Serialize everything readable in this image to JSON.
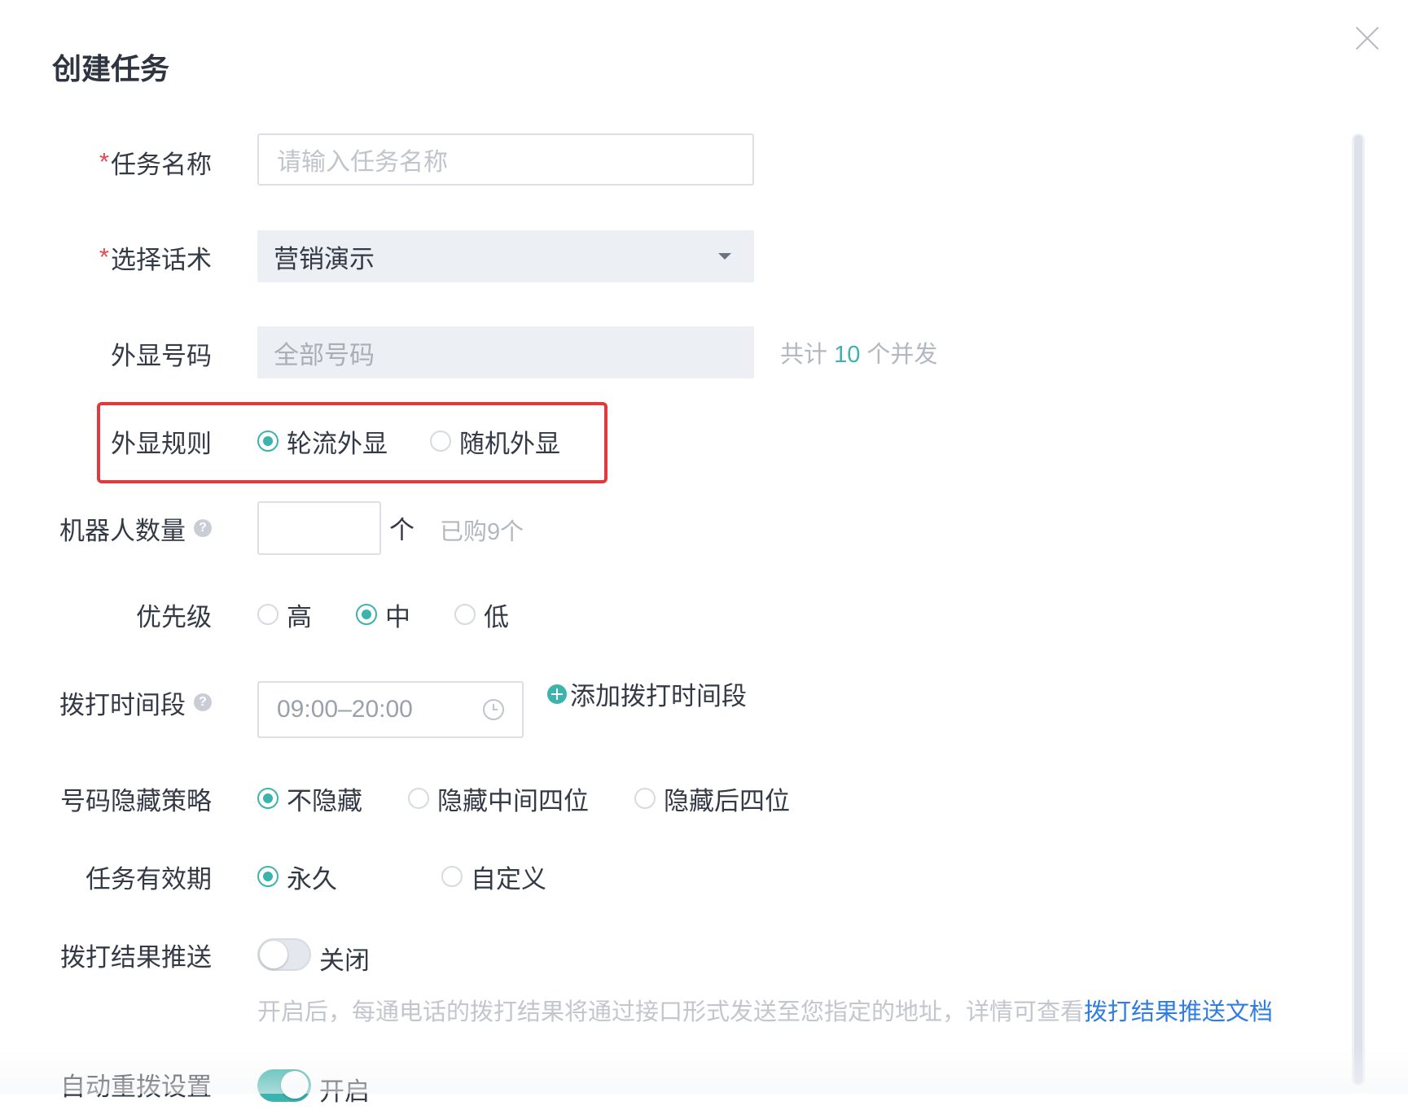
{
  "dialog": {
    "title": "创建任务"
  },
  "form": {
    "task_name": {
      "label": "任务名称",
      "required_mark": "*",
      "placeholder": "请输入任务名称",
      "value": ""
    },
    "script": {
      "label": "选择话术",
      "required_mark": "*",
      "value": "营销演示"
    },
    "caller_id": {
      "label": "外显号码",
      "value": "全部号码",
      "note_prefix": "共计 ",
      "note_count": "10",
      "note_suffix": " 个并发"
    },
    "caller_rule": {
      "label": "外显规则",
      "options": [
        "轮流外显",
        "随机外显"
      ],
      "selected": "轮流外显"
    },
    "robot_count": {
      "label": "机器人数量",
      "unit": "个",
      "purchased": "已购9个",
      "help": "?"
    },
    "priority": {
      "label": "优先级",
      "options": [
        "高",
        "中",
        "低"
      ],
      "selected": "中"
    },
    "call_period": {
      "label": "拨打时间段",
      "value": "09:00–20:00",
      "add_label": "添加拨打时间段",
      "help": "?"
    },
    "number_hiding": {
      "label": "号码隐藏策略",
      "options": [
        "不隐藏",
        "隐藏中间四位",
        "隐藏后四位"
      ],
      "selected": "不隐藏"
    },
    "validity": {
      "label": "任务有效期",
      "options": [
        "永久",
        "自定义"
      ],
      "selected": "永久"
    },
    "result_push": {
      "label": "拨打结果推送",
      "state": "关闭",
      "note": "开启后，每通电话的拨打结果将通过接口形式发送至您指定的地址，详情可查看",
      "link": "拨打结果推送文档"
    },
    "auto_redial": {
      "label": "自动重拨设置",
      "state": "开启"
    }
  },
  "colors": {
    "accent": "#3cb4ad",
    "required": "#e5484d",
    "highlight_border": "#e0393e",
    "link": "#2f7de0"
  },
  "icons": [
    "close-icon",
    "chevron-down-icon",
    "help-icon",
    "clock-icon",
    "plus-circle-icon"
  ]
}
